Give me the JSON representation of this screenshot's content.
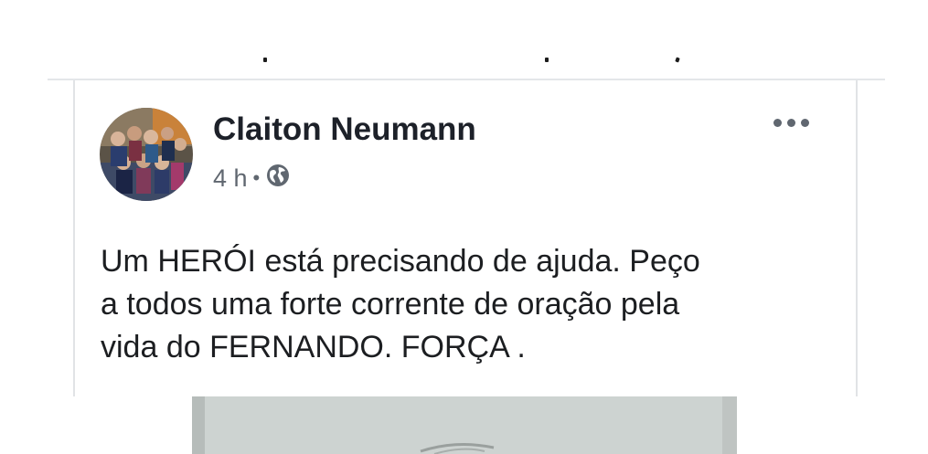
{
  "post": {
    "author": "Claiton Neumann",
    "time": "4 h",
    "separator": "•",
    "privacy_icon": "globe-icon",
    "more_icon": "more-options-icon",
    "text_lines": [
      "Um HERÓI está precisando de ajuda. Peço",
      "a todos uma forte corrente de oração pela",
      "vida do FERNANDO. FORÇA ."
    ]
  },
  "colors": {
    "text_primary": "#1d2129",
    "text_secondary": "#606770",
    "divider": "#e4e6e9"
  }
}
